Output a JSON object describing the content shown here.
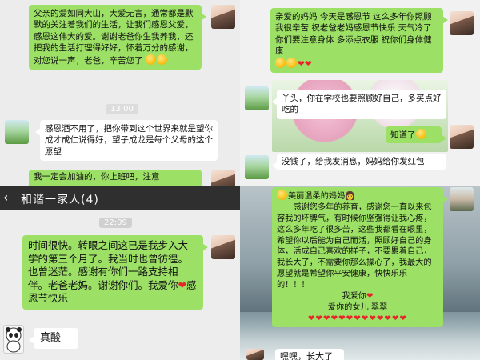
{
  "panel1": {
    "msg1": "父亲的爱如同大山，大爱无言，通常都是默默的关注着我们的生活，让我们感恩父爱，感恩这伟大的爱。谢谢老爸你生我养我，还把我的生活打理得好好，怀着万分的感谢，对您说一声，老爸，辛苦您了",
    "time": "13:00",
    "msg2": "感恩酒不用了，把你带到这个世界来就是望你成才成仁说得好，望子成龙是每个父母的这个愿望",
    "msg3": "我一定会加油的，你上班吧，注意"
  },
  "panel2": {
    "msg1": "亲爱的妈妈  今天是感恩节 这么多年你照顾我很辛苦  祝老爸老妈感恩节快乐  天气冷了你们要注意身体  多添点衣服 祝你们身体健康",
    "msg2": "丫头，你在学校也要照顾好自己，多买点好吃的",
    "msg3": "知道了",
    "msg4": "没钱了，给我发消息，妈妈给你发红包"
  },
  "panel3": {
    "back_icon": "back-chevron-icon",
    "title": "和谐一家人(4)",
    "time": "22:09",
    "msg1": "时间很快。转眼之间这已是我步入大学的第三个月了。我当时也曾彷徨。也曾迷茫。感谢有你们一路支持相伴。老爸老妈。谢谢你们。我爱你",
    "msg1_tail": "感恩节快乐",
    "msg2": "真酸"
  },
  "panel4": {
    "heading": "美丽温柔的妈妈",
    "body": "感谢您多年的养育，感谢您一直以来包容我的坏脾气，有时候你坚强得让我心疼，这么多年吃了很多苦，这些我都看在眼里，希望你以后能为自己而活，照顾好自己的身体，活成自己喜欢的样子，不要累着自己，我长大了，不需要你那么操心了，我最大的愿望就是希望你平安健康，快快乐乐的！！！",
    "line1": "我爱你",
    "line2": "爱你的女儿 翠翠",
    "reply": "嘿嘿，长大了"
  },
  "colors": {
    "green_bubble": "#9ce165",
    "white_bubble": "#ffffff",
    "header": "#2f2f2f",
    "heart": "#e8242a"
  }
}
